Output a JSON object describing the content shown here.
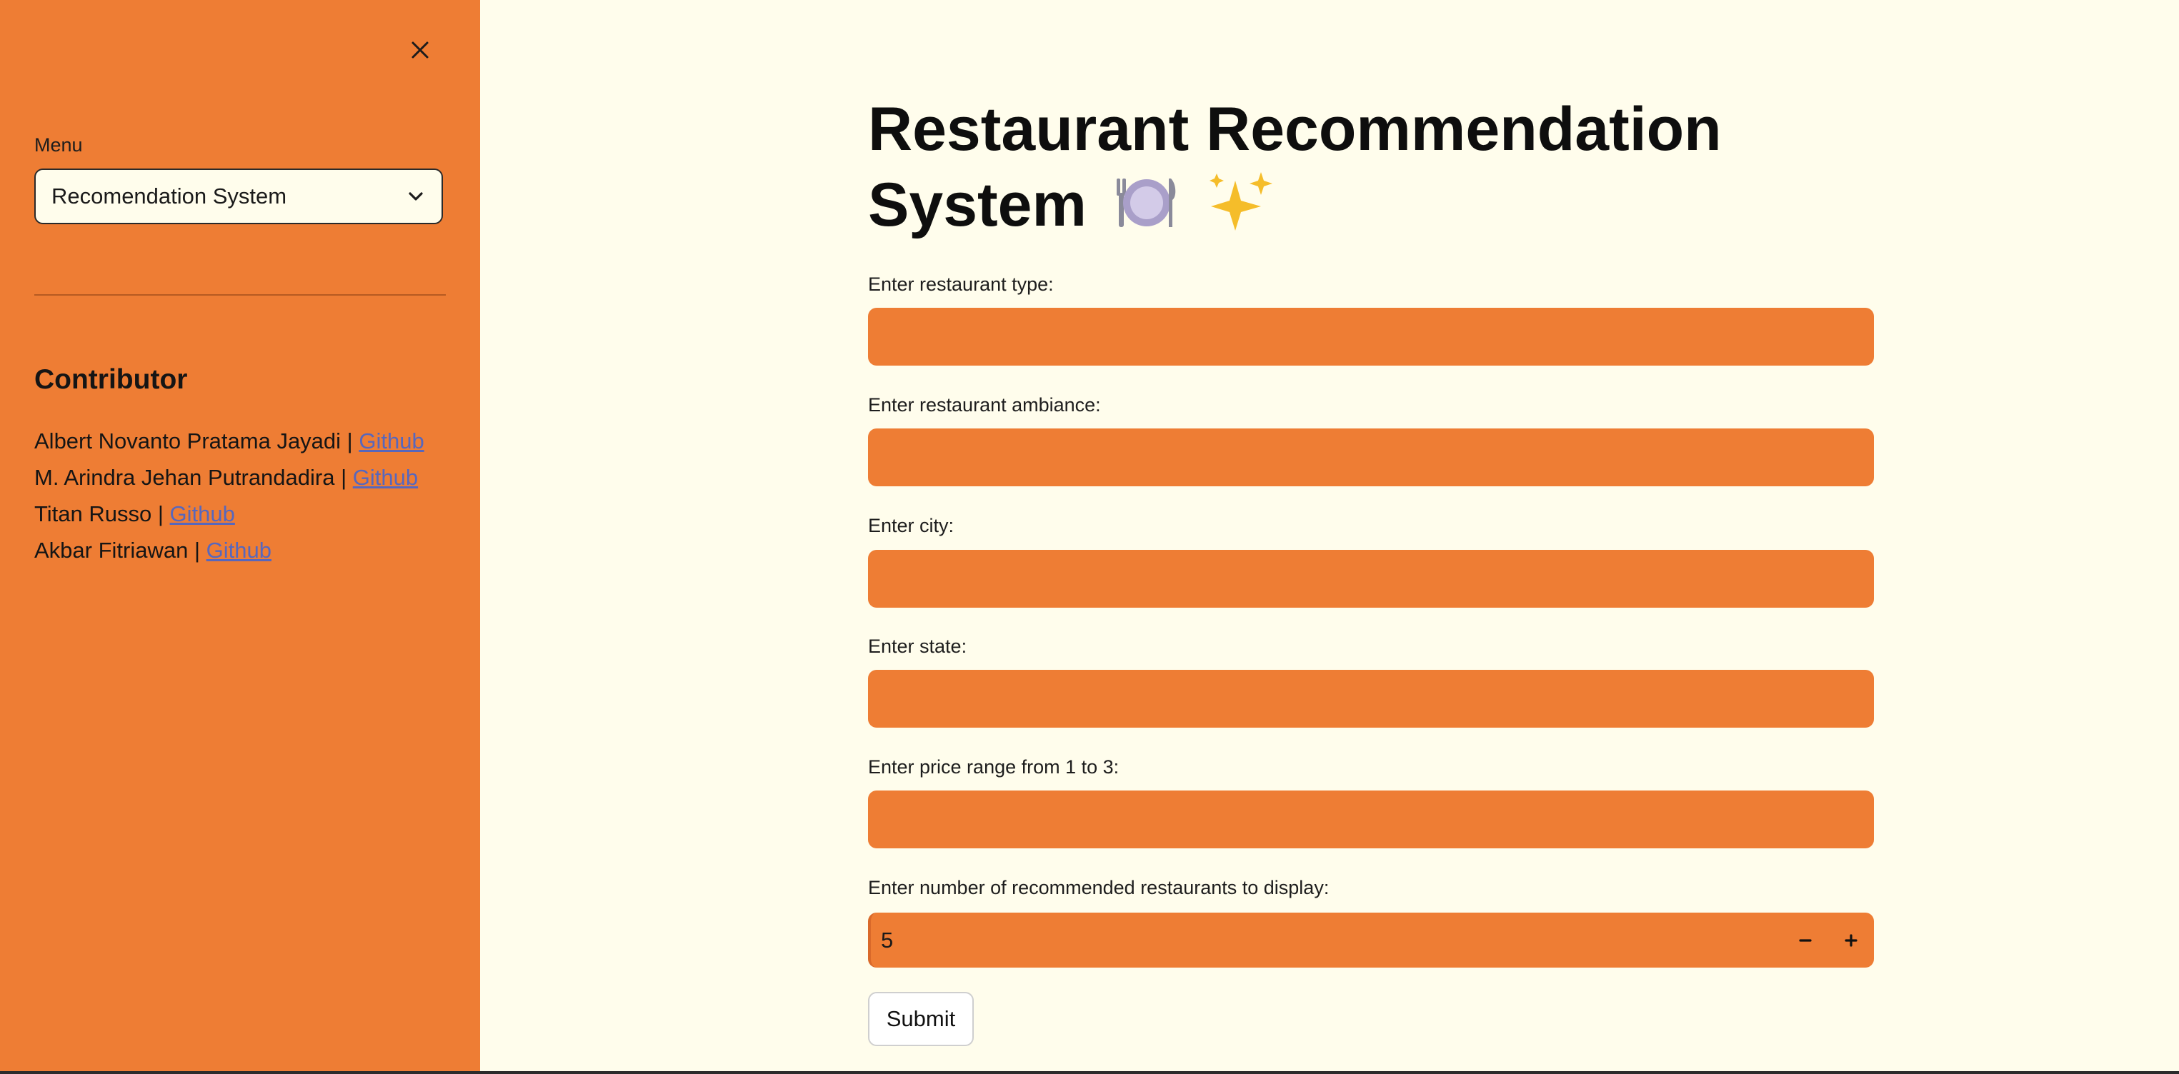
{
  "sidebar": {
    "close_icon": "close-icon",
    "menu_label": "Menu",
    "menu_selected": "Recomendation System",
    "contributor_title": "Contributor",
    "contributors": [
      {
        "name": "Albert Novanto Pratama Jayadi |",
        "link": "Github"
      },
      {
        "name": "M. Arindra Jehan Putrandadira |",
        "link": "Github"
      },
      {
        "name": "Titan Russo |",
        "link": "Github"
      },
      {
        "name": "Akbar Fitriawan |",
        "link": "Github"
      }
    ]
  },
  "main": {
    "title": "Restaurant Recommendation System",
    "title_emojis": [
      "plate-with-cutlery-icon",
      "sparkles-icon"
    ],
    "fields": [
      {
        "label": "Enter restaurant type:",
        "value": ""
      },
      {
        "label": "Enter restaurant ambiance:",
        "value": ""
      },
      {
        "label": "Enter city:",
        "value": ""
      },
      {
        "label": "Enter state:",
        "value": ""
      },
      {
        "label": "Enter price range from 1 to 3:",
        "value": ""
      }
    ],
    "number_field": {
      "label": "Enter number of recommended restaurants to display:",
      "value": "5"
    },
    "submit_label": "Submit"
  },
  "colors": {
    "sidebar_bg": "#ee7d34",
    "page_bg": "#fffdec",
    "input_bg": "#ee7d34",
    "link": "#3d64d6"
  }
}
